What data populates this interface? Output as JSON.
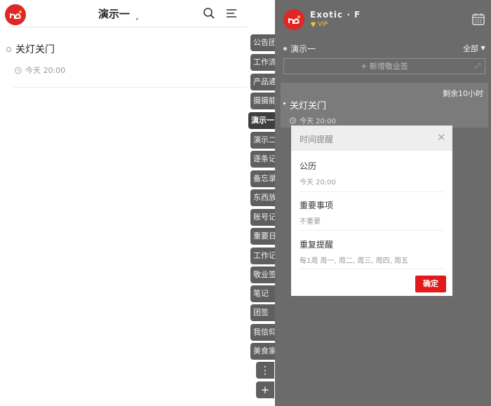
{
  "left": {
    "title": "演示一",
    "title_mark": "ˏ",
    "note": {
      "title": "关灯关门",
      "time": "今天 20:00"
    },
    "tabs": [
      "公告团",
      "工作流",
      "产品通",
      "摄摄能",
      "演示一",
      "演示二",
      "逐条记",
      "备忘录",
      "东西放",
      "账号记",
      "重要日",
      "工作记",
      "敬业签",
      "笔记",
      "团签",
      "我信仰",
      "美食家"
    ],
    "active_tab": "演示一",
    "tab_more": "⋮",
    "tab_add": "+"
  },
  "right": {
    "user_name": "Exotic · F",
    "vip_label": "VIP",
    "category": "演示一",
    "filter_label": "全部",
    "add_button": "+ 新增敬业签",
    "note": {
      "remaining": "剩余10小时",
      "title": "关灯关门",
      "time": "今天 20:00"
    },
    "modal": {
      "title": "时间提醒",
      "items": [
        {
          "label": "公历",
          "value": "今天 20:00"
        },
        {
          "label": "重要事项",
          "value": "不重要"
        },
        {
          "label": "重复提醒",
          "value": "每1周 周一, 周二, 周三, 周四, 周五"
        }
      ],
      "confirm": "确定"
    }
  },
  "colors": {
    "brand_red": "#e02727",
    "vip_gold": "#f1c232",
    "dark_panel": "#6b6b6b"
  }
}
